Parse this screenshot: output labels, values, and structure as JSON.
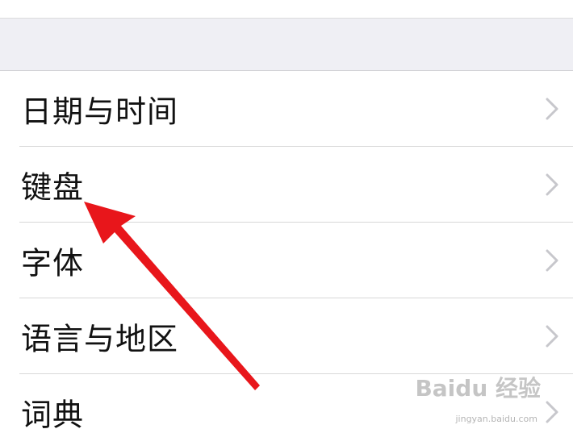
{
  "settings_list": {
    "items": [
      {
        "label": "日期与时间"
      },
      {
        "label": "键盘"
      },
      {
        "label": "字体"
      },
      {
        "label": "语言与地区"
      },
      {
        "label": "词典"
      }
    ]
  },
  "icons": {
    "chevron": "chevron-right-icon",
    "annotation": "red-arrow-icon"
  },
  "colors": {
    "group_background": "#efeff4",
    "separator": "#d8d8d8",
    "chevron": "#c7c7cc",
    "annotation_arrow": "#e8161b"
  },
  "watermark": {
    "logo": "Baidu 经验",
    "url": "jingyan.baidu.com"
  }
}
